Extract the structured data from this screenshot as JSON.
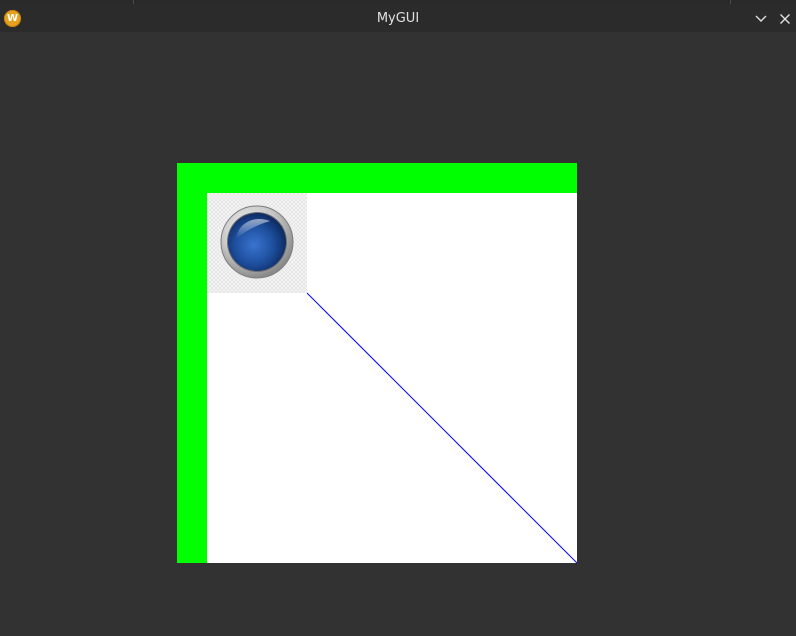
{
  "window": {
    "title": "MyGUI",
    "icon": "app-logo-icon",
    "icon_letter": "W",
    "colors": {
      "background": "#323232",
      "titlebar": "#2b2b2b",
      "title_text": "#e0e0e0",
      "app_icon": "#e6a21c"
    }
  },
  "titlebar_buttons": {
    "minimize_icon": "chevron-down-icon",
    "close_icon": "close-icon"
  },
  "scene": {
    "frame_color": "#00ff00",
    "panel_color": "#ffffff",
    "line_color": "#0000ff",
    "sphere_color": "#1f4f9a",
    "image_icon": "blue-sphere-button-icon"
  }
}
